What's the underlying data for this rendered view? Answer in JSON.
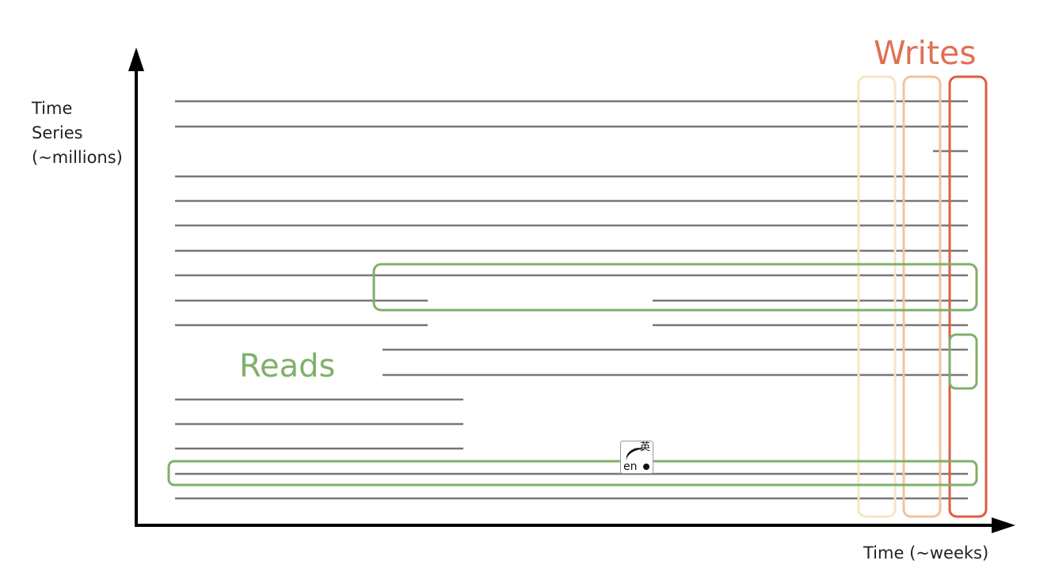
{
  "y_axis_label": [
    "Time",
    "Series",
    "(~millions)"
  ],
  "x_axis_label": "Time (~weeks)",
  "reads_label": "Reads",
  "writes_label": "Writes",
  "colors": {
    "axis": "#000000",
    "series_line": "#777777",
    "reads": "#7fb06a",
    "writes": "#e07054",
    "write_window_1": "#f7e6c4",
    "write_window_2": "#f2c39c",
    "write_window_3": "#de5e42"
  },
  "translate_icon": {
    "name": "translate-icon",
    "cjk": "英",
    "latin": "en"
  }
}
